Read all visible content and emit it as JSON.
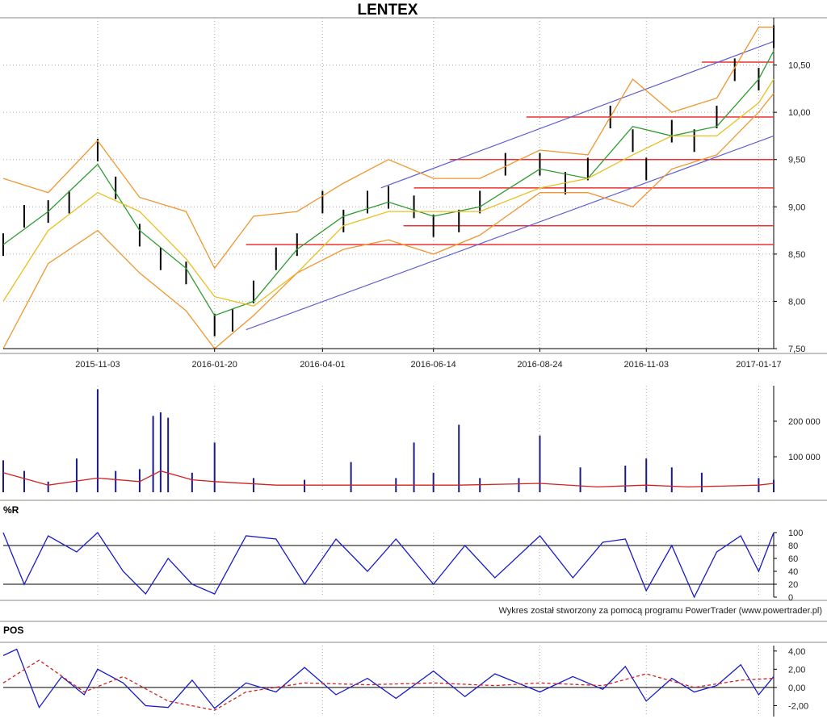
{
  "chart_data": [
    {
      "panel": "price",
      "type": "line",
      "title": "LENTEX",
      "x_tick_labels": [
        "2015-11-03",
        "2016-01-20",
        "2016-04-01",
        "2016-06-14",
        "2016-08-24",
        "2016-11-03",
        "2017-01-17"
      ],
      "y_tick_labels": [
        "7,50",
        "8,00",
        "8,50",
        "9,00",
        "9,50",
        "10,00",
        "10,50"
      ],
      "ylim": [
        7.5,
        11.0
      ],
      "grid": true,
      "series": [
        {
          "style": "ohlc bars",
          "color": "#000000",
          "x": [
            "2015-09-01",
            "2015-09-15",
            "2015-10-01",
            "2015-10-15",
            "2015-11-03",
            "2015-11-15",
            "2015-12-01",
            "2015-12-15",
            "2016-01-01",
            "2016-01-20",
            "2016-02-01",
            "2016-02-15",
            "2016-03-01",
            "2016-03-15",
            "2016-04-01",
            "2016-04-15",
            "2016-05-01",
            "2016-05-15",
            "2016-06-01",
            "2016-06-14",
            "2016-07-01",
            "2016-07-15",
            "2016-08-01",
            "2016-08-24",
            "2016-09-10",
            "2016-09-25",
            "2016-10-10",
            "2016-10-25",
            "2016-11-03",
            "2016-11-20",
            "2016-12-05",
            "2016-12-20",
            "2017-01-01",
            "2017-01-17",
            "2017-01-27"
          ],
          "values": [
            8.6,
            8.9,
            8.95,
            9.05,
            9.6,
            9.2,
            8.7,
            8.45,
            8.3,
            7.75,
            7.8,
            8.1,
            8.45,
            8.6,
            9.05,
            8.85,
            9.05,
            9.1,
            9.0,
            8.8,
            8.85,
            9.05,
            9.45,
            9.45,
            9.25,
            9.4,
            9.95,
            9.7,
            9.4,
            9.8,
            9.7,
            9.95,
            10.45,
            10.35,
            10.8
          ]
        },
        {
          "style": "moving average",
          "color": "#2e9b2e",
          "x": [
            "2015-09-01",
            "2015-10-01",
            "2015-11-03",
            "2015-12-01",
            "2016-01-01",
            "2016-01-20",
            "2016-02-15",
            "2016-03-15",
            "2016-04-15",
            "2016-05-15",
            "2016-06-14",
            "2016-07-15",
            "2016-08-24",
            "2016-09-25",
            "2016-10-25",
            "2016-11-20",
            "2016-12-20",
            "2017-01-17",
            "2017-01-27"
          ],
          "values": [
            8.6,
            8.95,
            9.45,
            8.75,
            8.35,
            7.85,
            8.0,
            8.55,
            8.9,
            9.05,
            8.9,
            9.0,
            9.4,
            9.3,
            9.85,
            9.75,
            9.85,
            10.35,
            10.65
          ]
        },
        {
          "style": "moving average",
          "color": "#e8c020",
          "x": [
            "2015-09-01",
            "2015-10-01",
            "2015-11-03",
            "2015-12-01",
            "2016-01-01",
            "2016-01-20",
            "2016-02-15",
            "2016-03-15",
            "2016-04-15",
            "2016-05-15",
            "2016-06-14",
            "2016-07-15",
            "2016-08-24",
            "2016-09-25",
            "2016-10-25",
            "2016-11-20",
            "2016-12-20",
            "2017-01-17",
            "2017-01-27"
          ],
          "values": [
            8.0,
            8.75,
            9.15,
            8.95,
            8.45,
            8.05,
            7.95,
            8.3,
            8.8,
            8.95,
            8.95,
            8.95,
            9.2,
            9.3,
            9.55,
            9.75,
            9.75,
            10.1,
            10.35
          ]
        },
        {
          "style": "bollinger upper",
          "color": "#f0962e",
          "x": [
            "2015-09-01",
            "2015-10-01",
            "2015-11-03",
            "2015-12-01",
            "2016-01-01",
            "2016-01-20",
            "2016-02-15",
            "2016-03-15",
            "2016-04-15",
            "2016-05-15",
            "2016-06-14",
            "2016-07-15",
            "2016-08-24",
            "2016-09-25",
            "2016-10-25",
            "2016-11-20",
            "2016-12-20",
            "2017-01-17",
            "2017-01-27"
          ],
          "values": [
            9.3,
            9.15,
            9.7,
            9.1,
            8.95,
            8.35,
            8.9,
            8.95,
            9.25,
            9.5,
            9.3,
            9.3,
            9.6,
            9.55,
            10.35,
            10.0,
            10.15,
            10.9,
            10.9
          ]
        },
        {
          "style": "bollinger lower",
          "color": "#f0962e",
          "x": [
            "2015-09-01",
            "2015-10-01",
            "2015-11-03",
            "2015-12-01",
            "2016-01-01",
            "2016-01-20",
            "2016-02-15",
            "2016-03-15",
            "2016-04-15",
            "2016-05-15",
            "2016-06-14",
            "2016-07-15",
            "2016-08-24",
            "2016-09-25",
            "2016-10-25",
            "2016-11-20",
            "2016-12-20",
            "2017-01-17",
            "2017-01-27"
          ],
          "values": [
            7.5,
            8.4,
            8.75,
            8.3,
            7.9,
            7.5,
            7.85,
            8.3,
            8.55,
            8.65,
            8.5,
            8.7,
            9.15,
            9.15,
            9.0,
            9.4,
            9.55,
            10.0,
            10.2
          ]
        }
      ],
      "channel_lines": [
        {
          "color": "#6060d0",
          "x": [
            "2016-02-10",
            "2017-01-27"
          ],
          "values": [
            7.7,
            9.75
          ]
        },
        {
          "color": "#6060d0",
          "x": [
            "2016-05-10",
            "2017-01-27"
          ],
          "values": [
            9.2,
            10.75
          ]
        }
      ],
      "horizontal_lines": [
        {
          "color": "#ee3030",
          "y": 8.6,
          "from": "2016-02-10"
        },
        {
          "color": "#ee3030",
          "y": 8.8,
          "from": "2016-05-25"
        },
        {
          "color": "#ee3030",
          "y": 9.2,
          "from": "2016-06-01"
        },
        {
          "color": "#ee3030",
          "y": 9.5,
          "from": "2016-06-25"
        },
        {
          "color": "#ee3030",
          "y": 9.95,
          "from": "2016-08-15"
        },
        {
          "color": "#ee3030",
          "y": 10.53,
          "from": "2016-12-10"
        }
      ]
    },
    {
      "panel": "volume",
      "type": "bar",
      "y_tick_labels": [
        "100 000",
        "200 000"
      ],
      "ylim": [
        0,
        300000
      ],
      "series": [
        {
          "style": "volume bars",
          "color": "#1a1a8c",
          "x": [
            "2015-09-01",
            "2015-09-15",
            "2015-10-01",
            "2015-10-20",
            "2015-11-03",
            "2015-11-15",
            "2015-12-01",
            "2015-12-10",
            "2015-12-15",
            "2015-12-20",
            "2016-01-05",
            "2016-01-20",
            "2016-02-15",
            "2016-03-20",
            "2016-04-20",
            "2016-05-20",
            "2016-06-01",
            "2016-06-14",
            "2016-07-01",
            "2016-07-15",
            "2016-08-10",
            "2016-08-24",
            "2016-09-20",
            "2016-10-20",
            "2016-11-03",
            "2016-11-20",
            "2016-12-10",
            "2017-01-17",
            "2017-01-27"
          ],
          "values": [
            90000,
            60000,
            30000,
            95000,
            290000,
            60000,
            65000,
            215000,
            225000,
            210000,
            55000,
            140000,
            40000,
            35000,
            85000,
            40000,
            140000,
            55000,
            190000,
            40000,
            40000,
            160000,
            70000,
            75000,
            95000,
            70000,
            55000,
            40000,
            35000
          ]
        },
        {
          "style": "volume average",
          "color": "#d02020",
          "x": [
            "2015-09-01",
            "2015-10-01",
            "2015-11-03",
            "2015-12-01",
            "2015-12-15",
            "2016-01-05",
            "2016-01-20",
            "2016-03-01",
            "2016-05-01",
            "2016-07-01",
            "2016-08-24",
            "2016-10-01",
            "2016-11-03",
            "2016-12-01",
            "2017-01-17",
            "2017-01-27"
          ],
          "values": [
            55000,
            20000,
            40000,
            30000,
            60000,
            35000,
            30000,
            20000,
            20000,
            20000,
            25000,
            15000,
            20000,
            15000,
            20000,
            25000
          ]
        }
      ]
    },
    {
      "panel": "williams_r",
      "type": "line",
      "title": "%R",
      "y_tick_labels": [
        "0",
        "20",
        "40",
        "60",
        "80",
        "100"
      ],
      "ylim": [
        0,
        100
      ],
      "reference_lines": [
        20,
        80
      ],
      "series": [
        {
          "color": "#1a1ac8",
          "x": [
            "2015-09-01",
            "2015-09-15",
            "2015-10-01",
            "2015-10-20",
            "2015-11-03",
            "2015-11-20",
            "2015-12-05",
            "2015-12-20",
            "2016-01-05",
            "2016-01-20",
            "2016-02-10",
            "2016-03-01",
            "2016-03-20",
            "2016-04-10",
            "2016-05-01",
            "2016-05-20",
            "2016-06-14",
            "2016-07-05",
            "2016-07-25",
            "2016-08-24",
            "2016-09-15",
            "2016-10-05",
            "2016-10-20",
            "2016-11-03",
            "2016-11-20",
            "2016-12-05",
            "2016-12-20",
            "2017-01-05",
            "2017-01-17",
            "2017-01-27"
          ],
          "values": [
            100,
            20,
            95,
            70,
            100,
            40,
            5,
            60,
            20,
            5,
            95,
            90,
            20,
            90,
            40,
            90,
            20,
            80,
            30,
            95,
            30,
            85,
            90,
            10,
            80,
            0,
            70,
            95,
            40,
            100
          ]
        }
      ]
    },
    {
      "panel": "pos",
      "type": "line",
      "title": "POS",
      "y_tick_labels": [
        "-2,00",
        "0,00",
        "2,00",
        "4,00"
      ],
      "ylim": [
        -3.2,
        4.6
      ],
      "reference_lines": [
        0
      ],
      "series": [
        {
          "color": "#1a1ac8",
          "x": [
            "2015-09-01",
            "2015-09-10",
            "2015-09-25",
            "2015-10-10",
            "2015-10-25",
            "2015-11-03",
            "2015-11-20",
            "2015-12-05",
            "2015-12-20",
            "2016-01-05",
            "2016-01-20",
            "2016-02-10",
            "2016-03-01",
            "2016-03-20",
            "2016-04-10",
            "2016-05-01",
            "2016-05-20",
            "2016-06-14",
            "2016-07-05",
            "2016-07-25",
            "2016-08-24",
            "2016-09-15",
            "2016-10-05",
            "2016-10-20",
            "2016-11-03",
            "2016-11-20",
            "2016-12-05",
            "2016-12-20",
            "2017-01-05",
            "2017-01-17",
            "2017-01-27"
          ],
          "values": [
            3.5,
            4.2,
            -2.2,
            1.2,
            -0.8,
            2.0,
            0.5,
            -2.0,
            -2.2,
            0.8,
            -2.3,
            0.5,
            -0.5,
            2.2,
            -0.8,
            1.0,
            -1.2,
            1.8,
            -1.0,
            1.5,
            -0.5,
            1.2,
            -0.2,
            2.3,
            -1.5,
            1.0,
            -0.5,
            0.2,
            2.5,
            -0.8,
            1.2
          ]
        },
        {
          "color": "#d02020",
          "dashed": true,
          "x": [
            "2015-09-01",
            "2015-09-25",
            "2015-10-25",
            "2015-11-20",
            "2015-12-20",
            "2016-01-20",
            "2016-02-10",
            "2016-03-20",
            "2016-05-01",
            "2016-06-14",
            "2016-07-25",
            "2016-08-24",
            "2016-10-05",
            "2016-11-03",
            "2016-12-05",
            "2017-01-05",
            "2017-01-27"
          ],
          "values": [
            0.5,
            3.0,
            -0.5,
            1.2,
            -1.5,
            -2.5,
            -0.5,
            0.5,
            0.3,
            0.5,
            0.2,
            0.5,
            0.2,
            1.5,
            0.0,
            0.8,
            1.0
          ]
        }
      ]
    }
  ],
  "credit": "Wykres został stworzony za pomocą programu PowerTrader (www.powertrader.pl)"
}
